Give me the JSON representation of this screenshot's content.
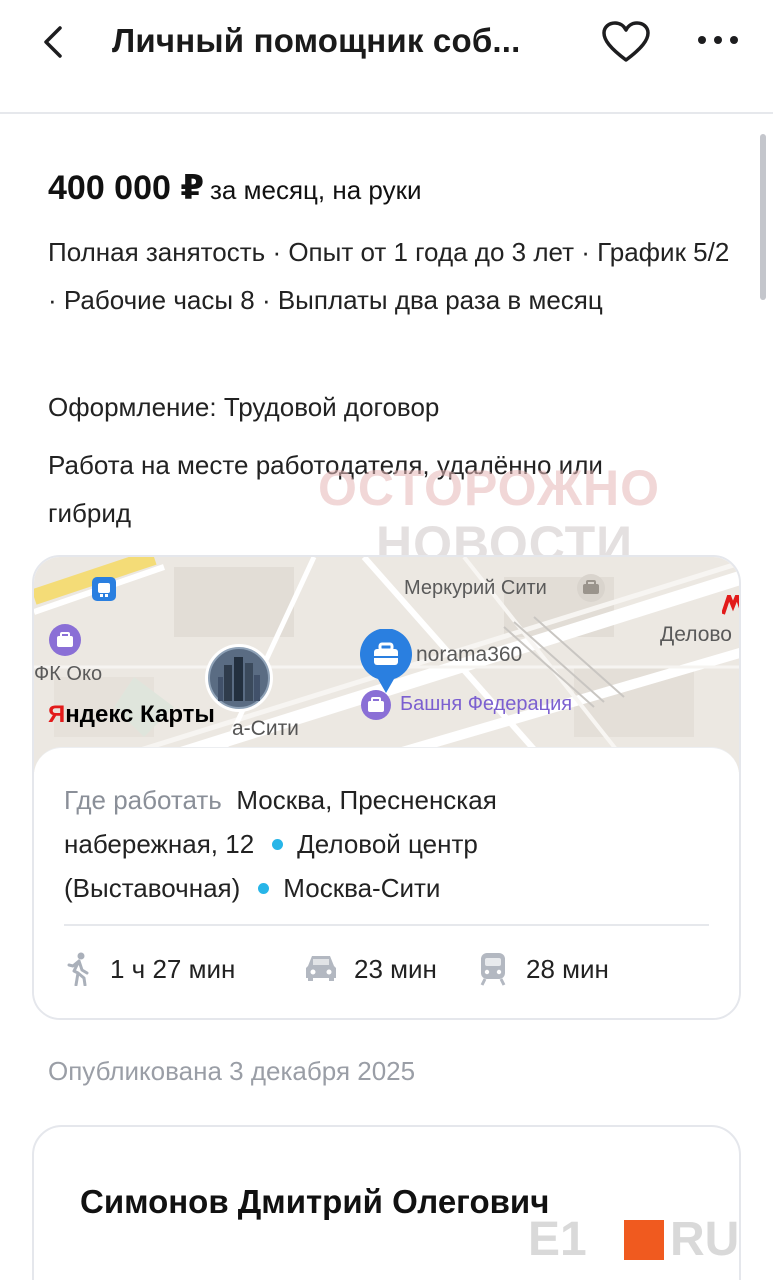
{
  "header": {
    "title": "Личный помощник соб...",
    "icons": [
      "back-chevron-icon",
      "heart-icon",
      "more-icon"
    ]
  },
  "vacancy": {
    "salary_amount": "400 000 ₽",
    "salary_unit": "за месяц, на руки",
    "conditions": "Полная занятость · Опыт от 1 года до 3 лет · График 5/2 · Рабочие часы 8 · Выплаты два раза в месяц",
    "contract": "Оформление: Трудовой договор",
    "work_format": "Работа на месте работодателя, удалённо или гибрид"
  },
  "watermark": {
    "line1": "ОСТОРОЖНО",
    "line2": "НОВОСТИ"
  },
  "map": {
    "labels": {
      "mercury": "Меркурий Сити",
      "delovoy": "Делово",
      "fk_oko": "ФК Око",
      "panorama": "norama360",
      "bashnya": "Башня Федерация",
      "city": "а-Сити"
    },
    "brand_ya": "Я",
    "brand_rest": "ндекс Карты",
    "colors": {
      "poi": "#8a6fd6",
      "pin": "#2a7fe0",
      "metro": "#e21a1a"
    }
  },
  "location": {
    "label": "Где работать",
    "address": "Москва, Пресненская набережная, 12",
    "metro1": "Деловой центр (Выставочная)",
    "metro2": "Москва-Сити",
    "metro_color": "#27b5e8"
  },
  "routes": {
    "walk": "1 ч 27 мин",
    "car": "23 мин",
    "transit": "28 мин"
  },
  "published": "Опубликована 3 декабря 2025",
  "employer": {
    "name": "Симонов Дмитрий Олегович"
  },
  "source_logo": {
    "left": "E1",
    "right": "RU",
    "accent": "#f05a1f"
  }
}
